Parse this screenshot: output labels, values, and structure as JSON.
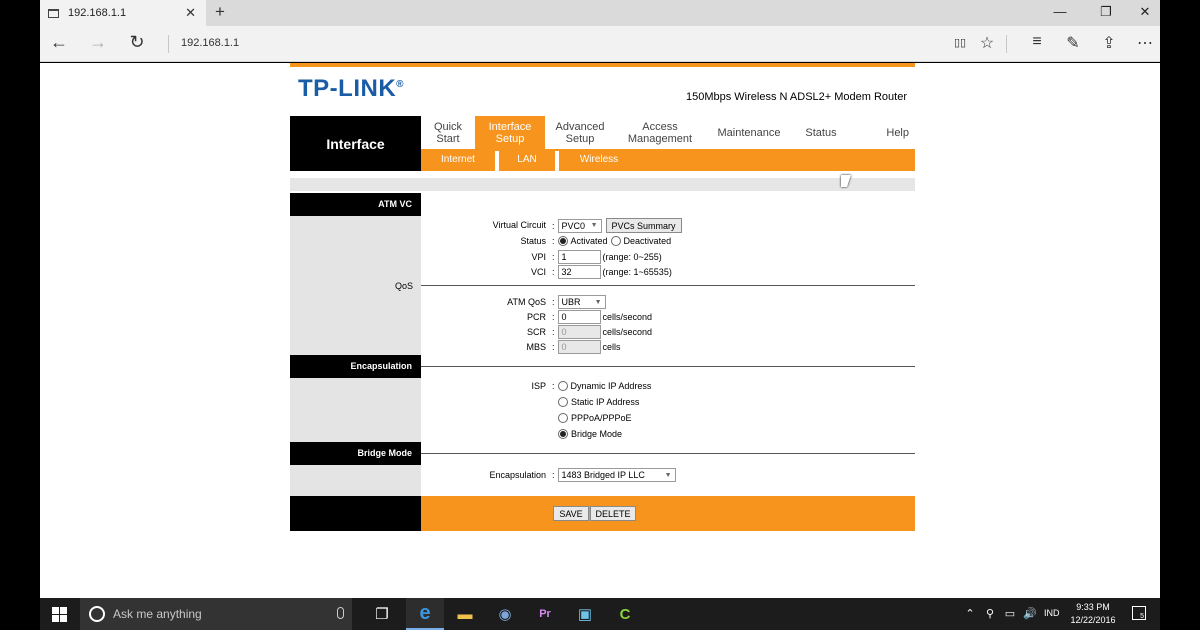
{
  "browser": {
    "tab_title": "192.168.1.1",
    "address": "192.168.1.1",
    "new_tab_glyph": "+",
    "close_tab_glyph": "✕",
    "controls": {
      "minimize": "—",
      "restore": "❐",
      "close": "✕"
    },
    "nav": {
      "back": "←",
      "forward": "→",
      "refresh": "↻"
    },
    "tools": {
      "reading_view": "▯▯",
      "favorite": "☆",
      "hub": "≡",
      "notes": "✎",
      "share": "⇪",
      "more": "⋯"
    }
  },
  "router": {
    "brand": "TP-LINK",
    "brand_mark": "®",
    "model": "150Mbps Wireless N ADSL2+ Modem Router",
    "section": "Interface",
    "nav": {
      "quick_start": [
        "Quick",
        "Start"
      ],
      "interface_setup": [
        "Interface",
        "Setup"
      ],
      "advanced_setup": [
        "Advanced",
        "Setup"
      ],
      "access_management": [
        "Access",
        "Management"
      ],
      "maintenance": "Maintenance",
      "status": "Status",
      "help": "Help"
    },
    "subnav": {
      "internet": "Internet",
      "lan": "LAN",
      "wireless": "Wireless"
    },
    "sections": {
      "atm_vc": "ATM VC",
      "qos": "QoS",
      "encapsulation": "Encapsulation",
      "bridge_mode": "Bridge Mode"
    },
    "atm": {
      "virtual_circuit_label": "Virtual Circuit",
      "virtual_circuit_value": "PVC0",
      "pvcs_summary": "PVCs Summary",
      "status_label": "Status",
      "status_options": [
        "Activated",
        "Deactivated"
      ],
      "status_selected": "Activated",
      "vpi_label": "VPI",
      "vpi_value": "1",
      "vpi_range": "(range: 0~255)",
      "vci_label": "VCI",
      "vci_value": "32",
      "vci_range": "(range: 1~65535)"
    },
    "qos": {
      "atm_qos_label": "ATM QoS",
      "atm_qos_value": "UBR",
      "pcr_label": "PCR",
      "pcr_value": "0",
      "scr_label": "SCR",
      "scr_value": "0",
      "mbs_label": "MBS",
      "mbs_value": "0",
      "cells_per_second": "cells/second",
      "cells": "cells"
    },
    "isp": {
      "label": "ISP",
      "options": [
        "Dynamic IP Address",
        "Static IP Address",
        "PPPoA/PPPoE",
        "Bridge Mode"
      ],
      "selected": "Bridge Mode"
    },
    "bridge": {
      "encapsulation_label": "Encapsulation",
      "encapsulation_value": "1483 Bridged IP LLC"
    },
    "buttons": {
      "save": "SAVE",
      "delete": "DELETE"
    },
    "colon": ":"
  },
  "taskbar": {
    "search_placeholder": "Ask me anything",
    "language": "IND",
    "time": "9:33 PM",
    "date": "12/22/2016",
    "notification_count": "5",
    "tray": {
      "chevron": "⌃",
      "network": "⚲",
      "battery": "▭",
      "volume": "🔊"
    },
    "apps": {
      "task_view": "❐",
      "edge": "e",
      "explorer": "▬",
      "browser": "◉",
      "premiere": "Pr",
      "pc": "▣",
      "camtasia": "C"
    }
  },
  "colors": {
    "accent": "#f7941d",
    "brand_blue": "#1a5ca5",
    "black_panel": "#000000",
    "grey_panel": "#e4e4e4"
  }
}
